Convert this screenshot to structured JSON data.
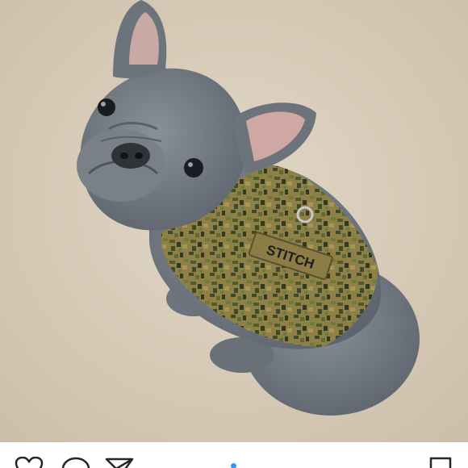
{
  "post": {
    "photo": {
      "subject": "",
      "vest_name_tape": "STITCH"
    },
    "actions": {
      "like_icon": "heart-outline-icon",
      "comment_icon": "speech-bubble-icon",
      "share_icon": "paper-plane-icon",
      "save_icon": "bookmark-icon"
    },
    "carousel": {
      "active_index": 1,
      "count": 1
    }
  },
  "colors": {
    "carpet": "#d8ccb9",
    "dog_fur": "#747a82",
    "vest_light": "#9a8a4c",
    "vest_dark": "#3d4b2a",
    "icon": "#262626",
    "accent_dot": "#3897f0"
  }
}
